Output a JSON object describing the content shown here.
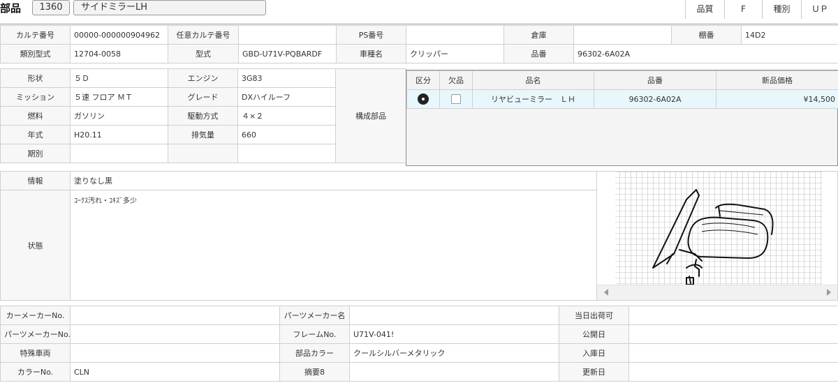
{
  "header": {
    "title": "部品",
    "code": "1360",
    "name": "サイドミラーLH",
    "quality_label": "品質",
    "quality_value": "F",
    "kind_label": "種別",
    "kind_value": "ＵＰ"
  },
  "top": {
    "karte_no_label": "カルテ番号",
    "karte_no": "00000-000000904962",
    "any_karte_label": "任意カルテ番号",
    "any_karte": "",
    "ps_label": "PS番号",
    "ps": "",
    "warehouse_label": "倉庫",
    "warehouse": "",
    "shelf_label": "棚番",
    "shelf": "14D2",
    "class_model_label": "類別型式",
    "class_model": "12704-0058",
    "model_label": "型式",
    "model": "GBD-U71V-PQBARDF",
    "car_name_label": "車種名",
    "car_name": "クリッパー",
    "part_no_label": "品番",
    "part_no": "96302-6A02A"
  },
  "spec": {
    "shape_label": "形状",
    "shape": "５Ｄ",
    "engine_label": "エンジン",
    "engine": "3G83",
    "mission_label": "ミッション",
    "mission": "５速 フロア ＭＴ",
    "grade_label": "グレード",
    "grade": "DXハイルーフ",
    "fuel_label": "燃料",
    "fuel": "ガソリン",
    "drive_label": "駆動方式",
    "drive": "４×２",
    "year_label": "年式",
    "year": "H20.11",
    "displacement_label": "排気量",
    "displacement": "660",
    "period_label": "期別",
    "period": "",
    "components_label": "構成部品"
  },
  "parts_table": {
    "headers": [
      "区分",
      "欠品",
      "品名",
      "品番",
      "新品価格"
    ],
    "rows": [
      {
        "name": "リヤビューミラー　ＬＨ",
        "number": "96302-6A02A",
        "price": "¥14,500",
        "missing": false,
        "icon": "disc-icon"
      }
    ]
  },
  "info": {
    "info_label": "情報",
    "info": "塗りなし黒",
    "condition_label": "状態",
    "condition": "ｺｰｸｽ汚れ・ｺｷｽﾞ多少"
  },
  "bottom": {
    "car_maker_no_label": "カーメーカーNo.",
    "car_maker_no": "",
    "parts_maker_name_label": "パーツメーカー名",
    "parts_maker_name": "",
    "same_day_label": "当日出荷可",
    "same_day": "",
    "parts_maker_no_label": "パーツメーカーNo.",
    "parts_maker_no": "",
    "frame_no_label": "フレームNo.",
    "frame_no": "U71V-041!",
    "publish_date_label": "公開日",
    "publish_date": "",
    "special_car_label": "特殊車両",
    "special_car": "",
    "part_color_label": "部品カラー",
    "part_color": "クールシルバーメタリック",
    "arrival_date_label": "入庫日",
    "arrival_date": "",
    "color_no_label": "カラーNo.",
    "color_no": "CLN",
    "summary8_label": "摘要8",
    "summary8": "",
    "update_date_label": "更新日",
    "update_date": ""
  },
  "colors": {
    "label_bg": "#f7f7f7",
    "row_highlight": "#e7f7fb",
    "border": "#cfcfcf"
  }
}
